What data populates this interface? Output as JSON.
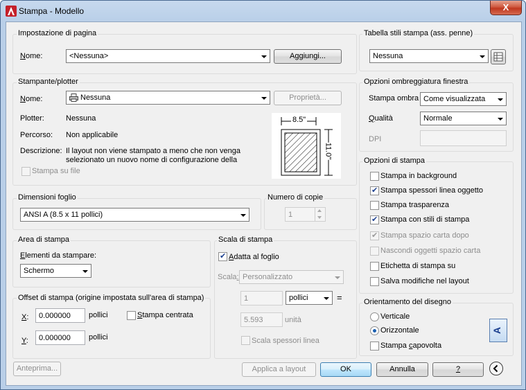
{
  "window": {
    "title": "Stampa - Modello",
    "close_glyph": "X"
  },
  "page_setup": {
    "group_label": "Impostazione di pagina",
    "name_label": "Nome:",
    "name_value": "<Nessuna>",
    "add_button": "Aggiungi..."
  },
  "printer": {
    "group_label": "Stampante/plotter",
    "name_label": "Nome:",
    "name_value": "Nessuna",
    "properties_button": "Proprietà...",
    "plotter_label": "Plotter:",
    "plotter_value": "Nessuna",
    "path_label": "Percorso:",
    "path_value": "Non applicabile",
    "description_label": "Descrizione:",
    "description_line1": "Il layout non viene stampato a meno che non venga",
    "description_line2": "selezionato un nuovo nome di configurazione della",
    "print_to_file": "Stampa su file",
    "preview_width": "8.5\"",
    "preview_height": "11.0\""
  },
  "paper_size": {
    "group_label": "Dimensioni foglio",
    "value": "ANSI A (8.5 x 11 pollici)"
  },
  "copies": {
    "group_label": "Numero di copie",
    "value": "1"
  },
  "plot_area": {
    "group_label": "Area di stampa",
    "what_label": "Elementi da stampare:",
    "what_value": "Schermo"
  },
  "plot_offset": {
    "group_label": "Offset di stampa (origine impostata sull'area di stampa)",
    "x_label": "X:",
    "x_value": "0.000000",
    "x_unit": "pollici",
    "y_label": "Y:",
    "y_value": "0.000000",
    "y_unit": "pollici",
    "center_label": "Stampa centrata"
  },
  "plot_scale": {
    "group_label": "Scala di stampa",
    "fit_label": "Adatta al foglio",
    "scale_label": "Scala:",
    "scale_value": "Personalizzato",
    "num_value": "1",
    "unit_value": "pollici",
    "equals": "=",
    "den_value": "5.593",
    "den_unit": "unità",
    "lineweights_label": "Scala spessori linea"
  },
  "style_table": {
    "group_label": "Tabella stili stampa (ass. penne)",
    "value": "Nessuna"
  },
  "shaded": {
    "group_label": "Opzioni ombreggiatura finestra",
    "shade_label": "Stampa ombra",
    "shade_value": "Come visualizzata",
    "quality_label": "Qualità",
    "quality_value": "Normale",
    "dpi_label": "DPI"
  },
  "options": {
    "group_label": "Opzioni di stampa",
    "items": [
      {
        "label": "Stampa in background",
        "checked": false,
        "enabled": true
      },
      {
        "label": "Stampa spessori linea oggetto",
        "checked": true,
        "enabled": true
      },
      {
        "label": "Stampa trasparenza",
        "checked": false,
        "enabled": true
      },
      {
        "label": "Stampa con stili di stampa",
        "checked": true,
        "enabled": true
      },
      {
        "label": "Stampa spazio carta dopo",
        "checked": true,
        "enabled": false
      },
      {
        "label": "Nascondi oggetti spazio carta",
        "checked": false,
        "enabled": false
      },
      {
        "label": "Etichetta di stampa su",
        "checked": false,
        "enabled": true
      },
      {
        "label": "Salva modifiche nel layout",
        "checked": false,
        "enabled": true
      }
    ]
  },
  "orientation": {
    "group_label": "Orientamento del disegno",
    "portrait": "Verticale",
    "landscape": "Orizzontale",
    "upside_down": "Stampa capovolta",
    "icon_letter": "A"
  },
  "footer": {
    "preview": "Anteprima...",
    "apply": "Applica a layout",
    "ok": "OK",
    "cancel": "Annulla",
    "help": "?"
  }
}
